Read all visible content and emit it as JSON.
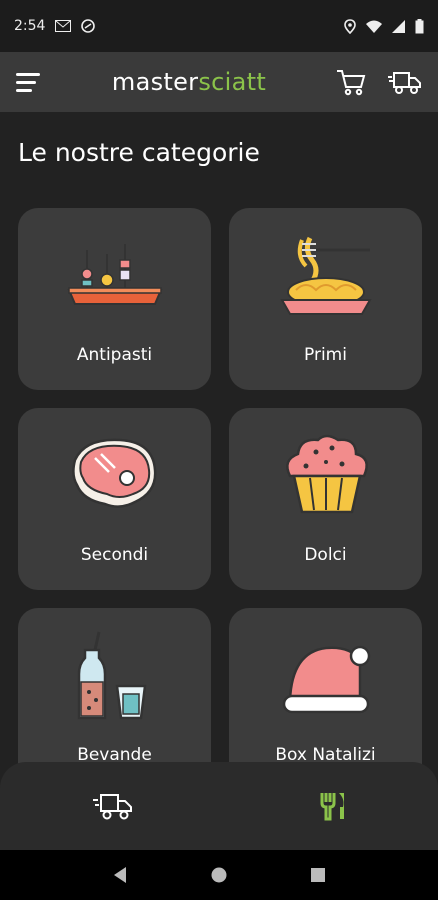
{
  "status_bar": {
    "time": "2:54"
  },
  "app_bar": {
    "brand_part1": "master",
    "brand_part2": "sciatt"
  },
  "page": {
    "title": "Le nostre categorie"
  },
  "categories": [
    {
      "label": "Antipasti"
    },
    {
      "label": "Primi"
    },
    {
      "label": "Secondi"
    },
    {
      "label": "Dolci"
    },
    {
      "label": "Bevande"
    },
    {
      "label": "Box Natalizi"
    }
  ],
  "colors": {
    "accent": "#8bc34a",
    "card": "#3c3c3c",
    "background": "#222222"
  },
  "icons": [
    "menu-icon",
    "cart-icon",
    "delivery-truck-icon",
    "fork-knife-icon",
    "back-icon",
    "home-icon",
    "recents-icon"
  ]
}
